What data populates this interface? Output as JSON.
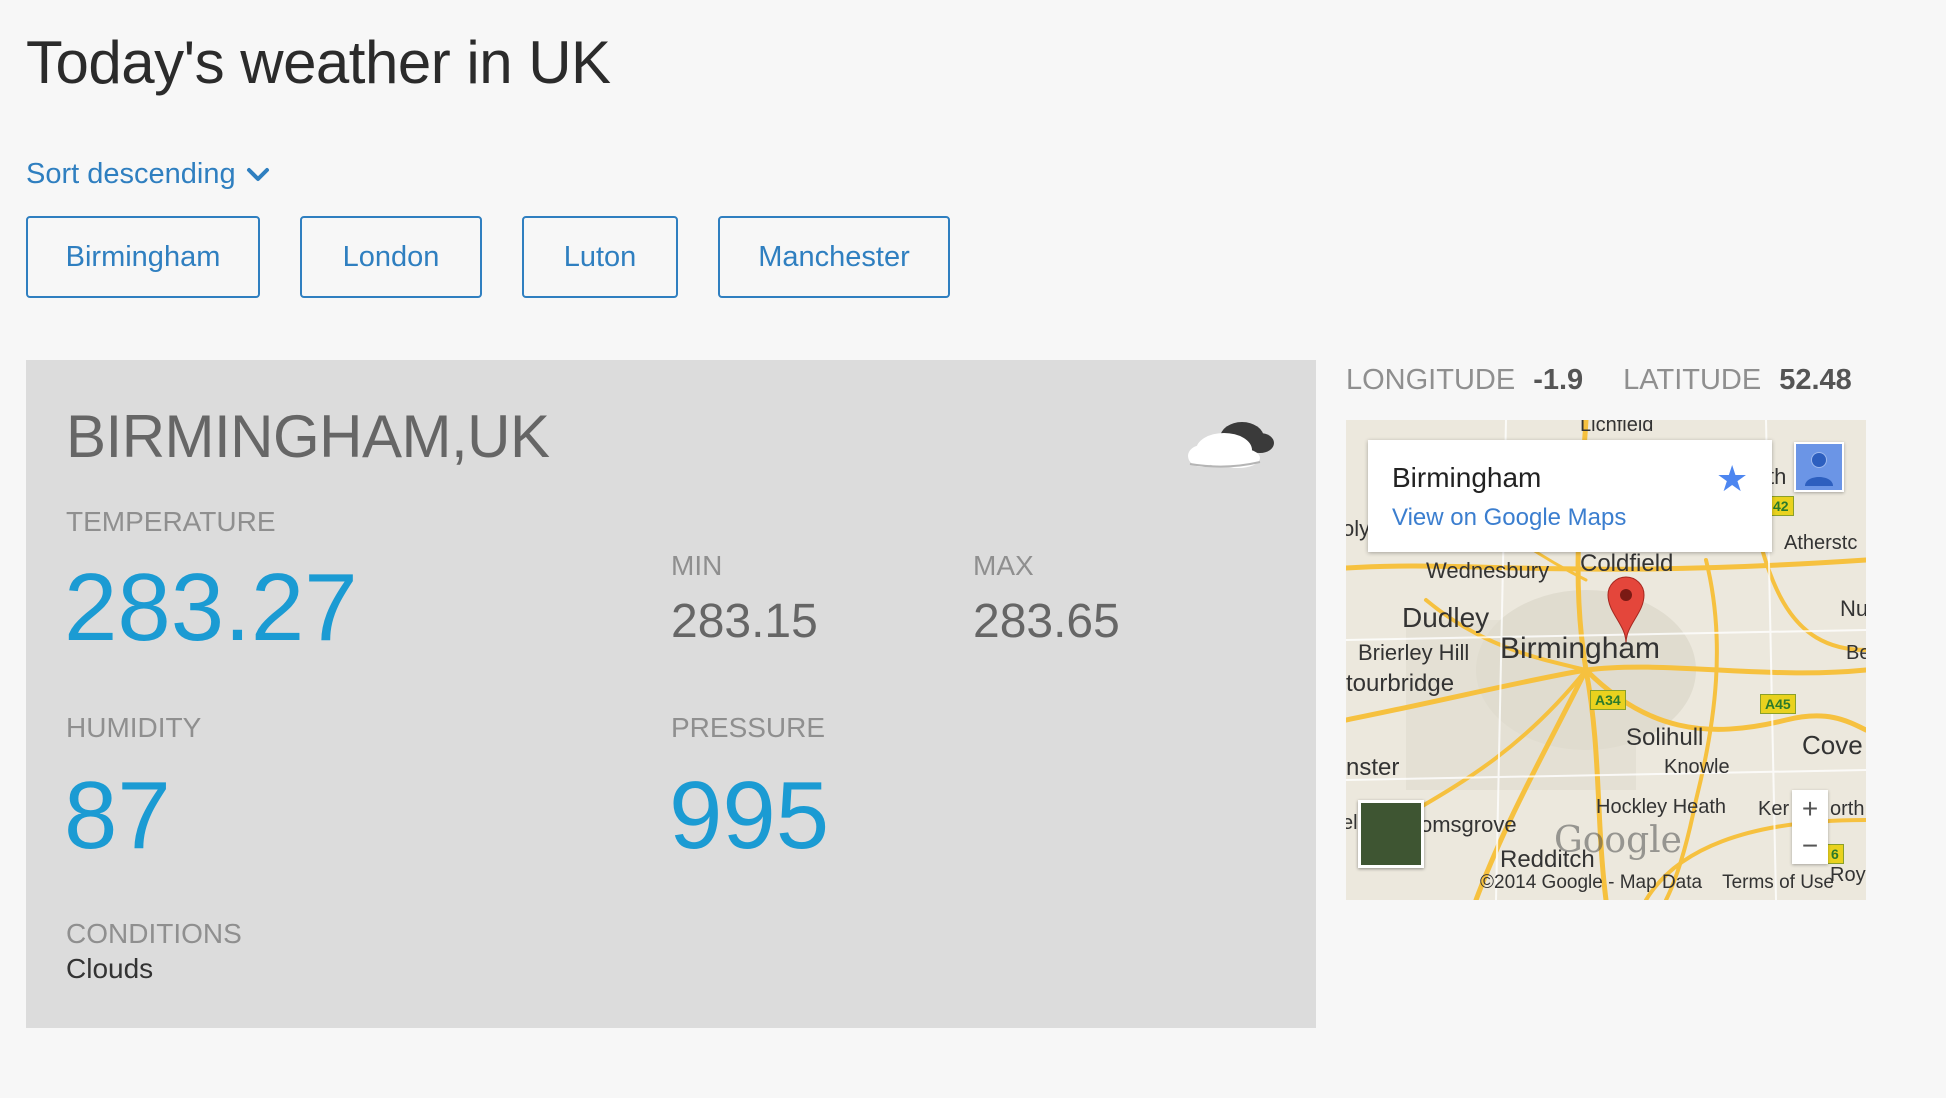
{
  "page": {
    "title": "Today's weather in UK"
  },
  "sort": {
    "label": "Sort descending"
  },
  "cities": [
    {
      "label": "Birmingham"
    },
    {
      "label": "London"
    },
    {
      "label": "Luton"
    },
    {
      "label": "Manchester"
    }
  ],
  "weather": {
    "city": "BIRMINGHAM,UK",
    "temperature_label": "TEMPERATURE",
    "temperature": "283.27",
    "min_label": "MIN",
    "min": "283.15",
    "max_label": "MAX",
    "max": "283.65",
    "humidity_label": "HUMIDITY",
    "humidity": "87",
    "pressure_label": "PRESSURE",
    "pressure": "995",
    "conditions_label": "CONDITIONS",
    "conditions": "Clouds",
    "icon": "cloud-icon"
  },
  "coords": {
    "longitude_label": "LONGITUDE",
    "longitude": "-1.9",
    "latitude_label": "LATITUDE",
    "latitude": "52.48"
  },
  "map": {
    "info_title": "Birmingham",
    "info_link": "View on Google Maps",
    "labels": {
      "wednesbury": "Wednesbury",
      "coldfield": "Coldfield",
      "dudley": "Dudley",
      "brierley_hill": "Brierley Hill",
      "birmingham": "Birmingham",
      "stourbridge": "tourbridge",
      "solihull": "Solihull",
      "knowle": "Knowle",
      "hockley_heath": "Hockley Heath",
      "bromsgrove": "omsgrove",
      "redditch": "Redditch",
      "kidderminster": "nster",
      "coventry": "Cove",
      "atherstone": "Atherstc",
      "nuneaton": "Nu",
      "kenilworth": "Ker",
      "north": "orth",
      "be": "Be",
      "th": "th",
      "lichfield": "Lichfield",
      "ol": "oly",
      "roy": "Roy",
      "el": "el"
    },
    "road_signs": {
      "a34": "A34",
      "a45": "A45",
      "r42": "42",
      "r6": "6"
    },
    "logo": "Google",
    "attribution": "©2014 Google - Map Data",
    "terms": "Terms of Use",
    "zoom_in": "+",
    "zoom_out": "−",
    "colors": {
      "roads": "#f6c13f",
      "water": "#a5c5e0",
      "marker": "#e4463b"
    }
  }
}
